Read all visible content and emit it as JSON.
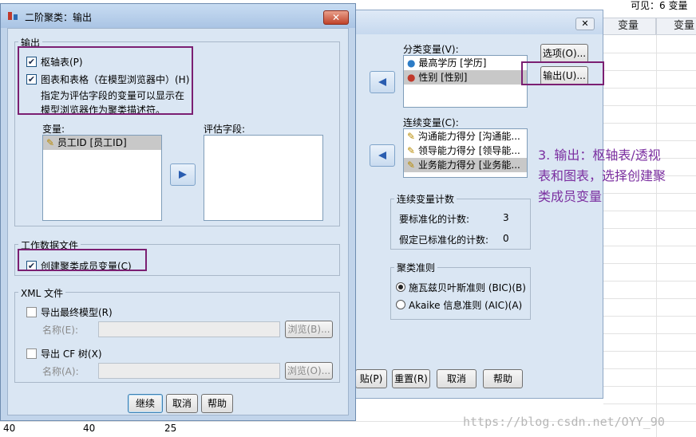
{
  "spreadsheet": {
    "visible_label": "可见：6 变量",
    "col_header_1": "变量",
    "col_header_2": "变量",
    "row_values": [
      "40",
      "40",
      "25"
    ]
  },
  "background_dialog": {
    "close_label": "✕",
    "categorical_label": "分类变量(V):",
    "categorical_items": [
      "最高学历 [学历]",
      "性别 [性别]"
    ],
    "options_button": "选项(O)...",
    "output_button": "输出(U)...",
    "continuous_label": "连续变量(C):",
    "continuous_items": [
      "沟通能力得分 [沟通能...",
      "领导能力得分 [领导能...",
      "业务能力得分 [业务能..."
    ],
    "count_group": "连续变量计数",
    "standardize_label": "要标准化的计数:",
    "standardize_value": "3",
    "assumed_label": "假定已标准化的计数:",
    "assumed_value": "0",
    "criterion_group": "聚类准则",
    "bic_label": "施瓦兹贝叶斯准则 (BIC)(B)",
    "aic_label": "Akaike 信息准则 (AIC)(A)",
    "paste_button": "贴(P)",
    "reset_button": "重置(R)",
    "cancel_button": "取消",
    "help_button": "帮助"
  },
  "dialog": {
    "title": "二阶聚类：输出",
    "close_label": "✕",
    "output_group": "输出",
    "pivot_label": "枢轴表(P)",
    "charts_label": "图表和表格（在模型浏览器中）(H)",
    "charts_note_1": "指定为评估字段的变量可以显示在",
    "charts_note_2": "模型浏览器作为聚类描述符。",
    "variables_label": "变量:",
    "variables_items": [
      "员工ID [员工ID]"
    ],
    "eval_label": "评估字段:",
    "working_group": "工作数据文件",
    "create_cluster_label": "创建聚类成员变量(C)",
    "xml_group": "XML 文件",
    "export_final_label": "导出最终模型(R)",
    "name_label_1": "名称(E):",
    "browse_1": "浏览(B)...",
    "export_cf_label": "导出 CF 树(X)",
    "name_label_2": "名称(A):",
    "browse_2": "浏览(O)...",
    "continue_button": "继续",
    "cancel_button": "取消",
    "help_button": "帮助"
  },
  "annotation": {
    "line1": "3. 输出：枢轴表/透视",
    "line2": "表和图表，选择创建聚",
    "line3": "类成员变量"
  },
  "watermark": "https://blog.csdn.net/OYY_90",
  "colors": {
    "highlight": "#7b1f72",
    "annotation": "#7b2fa0"
  }
}
